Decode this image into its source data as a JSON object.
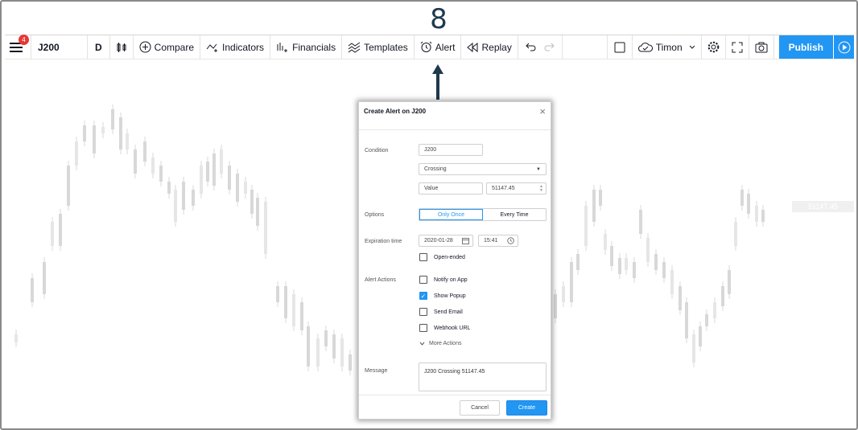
{
  "step_number": "8",
  "toolbar": {
    "menu_badge": "4",
    "symbol": "J200",
    "interval": "D",
    "compare_label": "Compare",
    "indicators_label": "Indicators",
    "financials_label": "Financials",
    "templates_label": "Templates",
    "alert_label": "Alert",
    "replay_label": "Replay",
    "layout_name": "Timon",
    "publish_label": "Publish"
  },
  "chart": {
    "last_price_tag": "51147.45",
    "candle_color": "#d8d8d8"
  },
  "dialog": {
    "title": "Create Alert on J200",
    "condition_label": "Condition",
    "condition_symbol": "J200",
    "condition_operator": "Crossing",
    "value_type": "Value",
    "value": "51147.45",
    "options_label": "Options",
    "option_once": "Only Once",
    "option_every": "Every Time",
    "expiration_label": "Expiration time",
    "expiration_date": "2020-01-28",
    "expiration_time": "15:41",
    "open_ended_label": "Open-ended",
    "alert_actions_label": "Alert Actions",
    "actions": [
      {
        "label": "Notify on App",
        "checked": false
      },
      {
        "label": "Show Popup",
        "checked": true
      },
      {
        "label": "Send Email",
        "checked": false
      },
      {
        "label": "Webhook URL",
        "checked": false
      }
    ],
    "more_actions": "More Actions",
    "message_label": "Message",
    "message": "J200 Crossing 51147.45",
    "cancel_label": "Cancel",
    "create_label": "Create"
  },
  "colors": {
    "accent": "#2196f3",
    "badge": "#e53935",
    "arrow": "#1f3a4d"
  }
}
